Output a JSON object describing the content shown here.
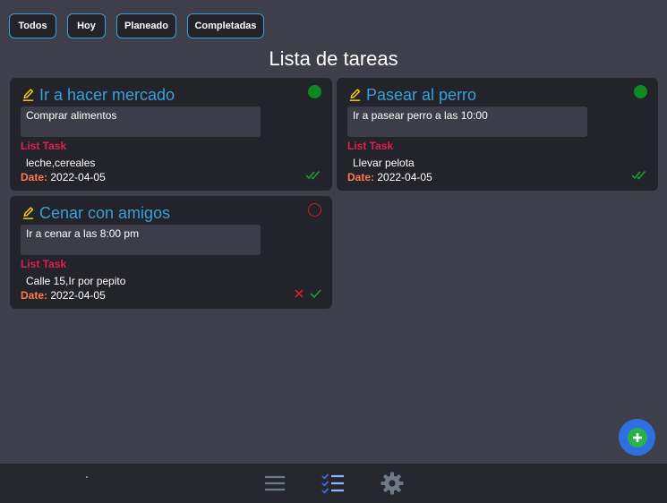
{
  "filters": [
    "Todos",
    "Hoy",
    "Planeado",
    "Completadas"
  ],
  "page_title": "Lista de tareas",
  "list_label": "List Task",
  "date_label": "Date:",
  "tasks": [
    {
      "title": "Ir a hacer mercado",
      "description": "Comprar alimentos",
      "items": "leche,cereales",
      "date": "2022-04-05",
      "status": "completed"
    },
    {
      "title": "Pasear al perro",
      "description": "Ir a pasear perro a las 10:00",
      "items": "Llevar pelota",
      "date": "2022-04-05",
      "status": "completed"
    },
    {
      "title": "Cenar con amigos",
      "description": "Ir a cenar a las 8:00 pm",
      "items": "Calle 15,Ir por pepito",
      "date": "2022-04-05",
      "status": "pending"
    }
  ],
  "colors": {
    "background": "#3f3f4c",
    "card": "#23232b",
    "accent_blue": "#3aa0d8",
    "list_label": "#e0214f",
    "date_label": "#ff7a4d",
    "done_green": "#0c8a1f",
    "pending_red": "#d41f1f"
  },
  "icons": {
    "edit": "pencil-icon",
    "fab": "plus-circle-icon",
    "nav": [
      "menu-icon",
      "checklist-icon",
      "gear-icon"
    ]
  }
}
